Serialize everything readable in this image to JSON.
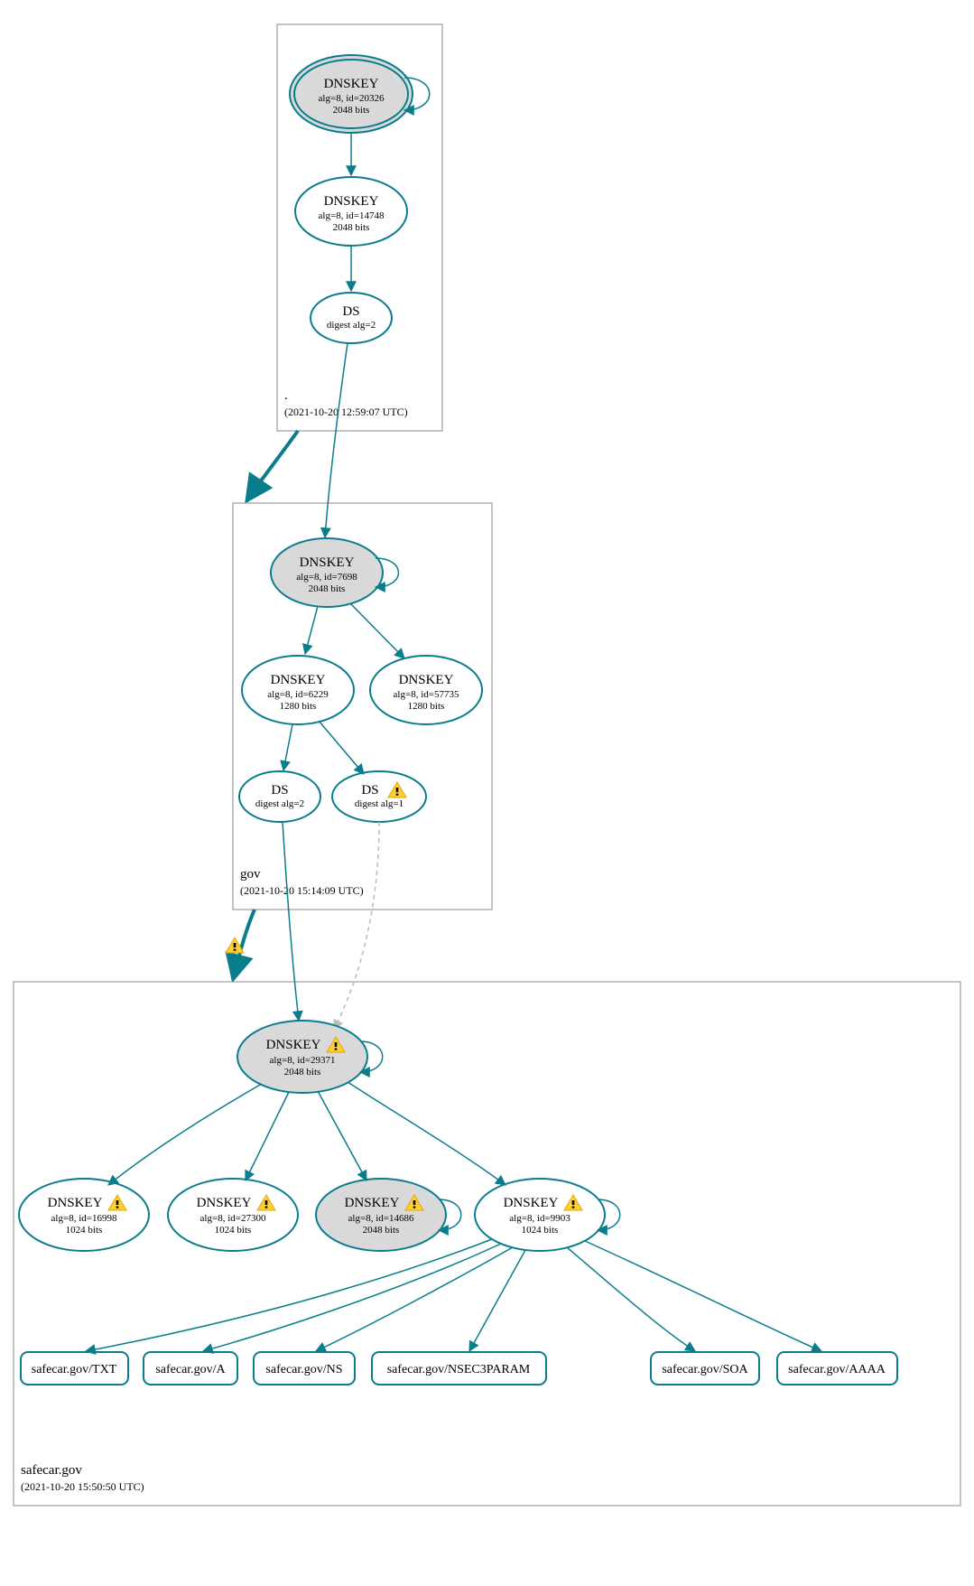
{
  "colors": {
    "teal": "#0a7d8c",
    "gray_fill": "#d9d9d9",
    "light_gray": "#bbbbbb"
  },
  "zones": {
    "root": {
      "label_title": ".",
      "label_sub": "(2021-10-20 12:59:07 UTC)"
    },
    "gov": {
      "label_title": "gov",
      "label_sub": "(2021-10-20 15:14:09 UTC)"
    },
    "safecar": {
      "label_title": "safecar.gov",
      "label_sub": "(2021-10-20 15:50:50 UTC)"
    }
  },
  "nodes": {
    "root_ksk": {
      "title": "DNSKEY",
      "line2": "alg=8, id=20326",
      "line3": "2048 bits"
    },
    "root_zsk": {
      "title": "DNSKEY",
      "line2": "alg=8, id=14748",
      "line3": "2048 bits"
    },
    "root_ds": {
      "title": "DS",
      "line2": "digest alg=2"
    },
    "gov_ksk": {
      "title": "DNSKEY",
      "line2": "alg=8, id=7698",
      "line3": "2048 bits"
    },
    "gov_zsk1": {
      "title": "DNSKEY",
      "line2": "alg=8, id=6229",
      "line3": "1280 bits"
    },
    "gov_zsk2": {
      "title": "DNSKEY",
      "line2": "alg=8, id=57735",
      "line3": "1280 bits"
    },
    "gov_ds1": {
      "title": "DS",
      "line2": "digest alg=2"
    },
    "gov_ds2": {
      "title": "DS",
      "line2": "digest alg=1"
    },
    "sc_ksk": {
      "title": "DNSKEY",
      "line2": "alg=8, id=29371",
      "line3": "2048 bits"
    },
    "sc_k1": {
      "title": "DNSKEY",
      "line2": "alg=8, id=16998",
      "line3": "1024 bits"
    },
    "sc_k2": {
      "title": "DNSKEY",
      "line2": "alg=8, id=27300",
      "line3": "1024 bits"
    },
    "sc_k3": {
      "title": "DNSKEY",
      "line2": "alg=8, id=14686",
      "line3": "2048 bits"
    },
    "sc_k4": {
      "title": "DNSKEY",
      "line2": "alg=8, id=9903",
      "line3": "1024 bits"
    }
  },
  "records": {
    "txt": "safecar.gov/TXT",
    "a": "safecar.gov/A",
    "ns": "safecar.gov/NS",
    "nsec3": "safecar.gov/NSEC3PARAM",
    "soa": "safecar.gov/SOA",
    "aaaa": "safecar.gov/AAAA"
  }
}
